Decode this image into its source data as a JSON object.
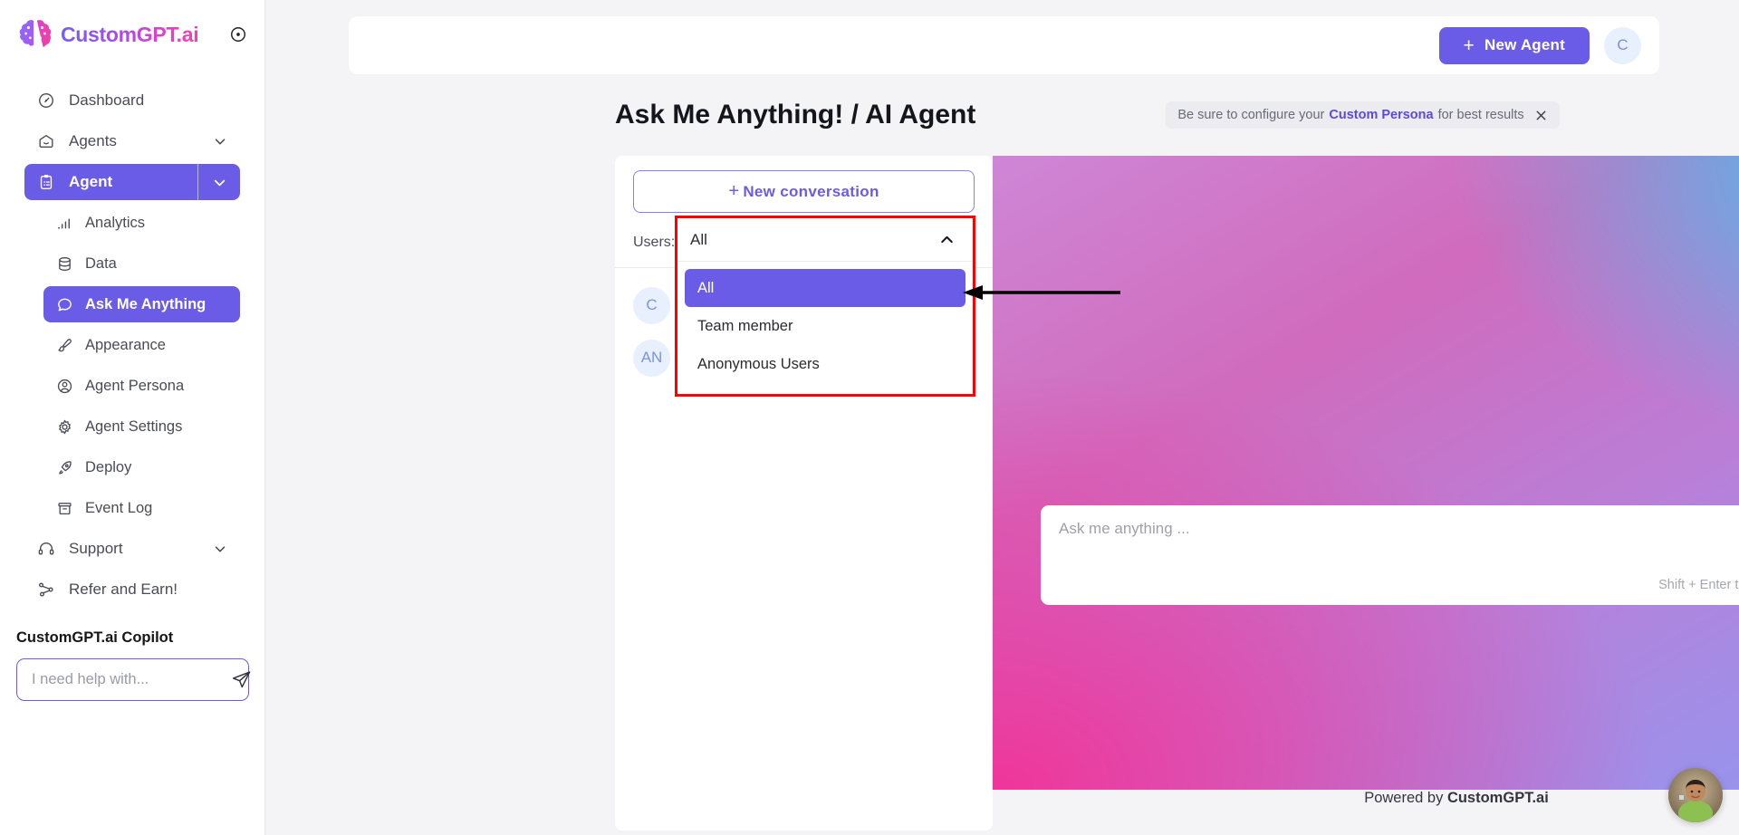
{
  "brand": {
    "name": "CustomGPT.ai",
    "logo_icon": "brain-logo",
    "collapse_icon": "collapse-circle-icon"
  },
  "sidebar": {
    "items": [
      {
        "label": "Dashboard",
        "icon": "dashboard-icon",
        "level": "top",
        "state": "default",
        "chevron": false
      },
      {
        "label": "Agents",
        "icon": "agents-icon",
        "level": "top",
        "state": "default",
        "chevron": true
      },
      {
        "label": "Agent",
        "icon": "clipboard-icon",
        "level": "top",
        "state": "active-split",
        "chevron": true
      },
      {
        "label": "Analytics",
        "icon": "analytics-bars-icon",
        "level": "sub",
        "state": "default",
        "chevron": false
      },
      {
        "label": "Data",
        "icon": "database-icon",
        "level": "sub",
        "state": "default",
        "chevron": false
      },
      {
        "label": "Ask Me Anything",
        "icon": "chat-bubble-icon",
        "level": "sub",
        "state": "active",
        "chevron": false
      },
      {
        "label": "Appearance",
        "icon": "paintbrush-icon",
        "level": "sub",
        "state": "default",
        "chevron": false
      },
      {
        "label": "Agent Persona",
        "icon": "user-circle-icon",
        "level": "sub",
        "state": "default",
        "chevron": false
      },
      {
        "label": "Agent Settings",
        "icon": "gear-icon",
        "level": "sub",
        "state": "default",
        "chevron": false
      },
      {
        "label": "Deploy",
        "icon": "rocket-icon",
        "level": "sub",
        "state": "default",
        "chevron": false
      },
      {
        "label": "Event Log",
        "icon": "archive-box-icon",
        "level": "sub",
        "state": "default",
        "chevron": false
      },
      {
        "label": "Support",
        "icon": "headset-icon",
        "level": "top",
        "state": "default",
        "chevron": true
      },
      {
        "label": "Refer and Earn!",
        "icon": "share-nodes-icon",
        "level": "top",
        "state": "default",
        "chevron": false
      }
    ],
    "copilot": {
      "title": "CustomGPT.ai Copilot",
      "placeholder": "I need help with...",
      "value": "",
      "send_icon": "send-paper-plane-icon"
    }
  },
  "topbar": {
    "new_agent_label": "New Agent",
    "new_agent_plus": "+",
    "avatar_initial": "C"
  },
  "header": {
    "title": "Ask Me Anything! / AI Agent",
    "notice_prefix": "Be sure to configure your",
    "notice_link": "Custom Persona",
    "notice_suffix": "for best results",
    "notice_close_icon": "close-icon",
    "export_icon": "download-document-icon",
    "share_icon": "share-icon"
  },
  "conversations": {
    "new_conversation_label": "New conversation",
    "new_conversation_plus": "+",
    "users_label": "Users:",
    "items": [
      {
        "initials": "C"
      },
      {
        "initials": "AN"
      }
    ]
  },
  "users_dropdown": {
    "selected": "All",
    "caret_icon": "chevron-up-icon",
    "expanded": true,
    "options": [
      {
        "label": "All",
        "selected": true
      },
      {
        "label": "Team member",
        "selected": false
      },
      {
        "label": "Anonymous Users",
        "selected": false
      }
    ],
    "highlight_color": "#ff0000",
    "option_selected_color": "#6b5ce7"
  },
  "chat": {
    "placeholder": "Ask me anything ...",
    "value": "",
    "hint": "Shift + Enter to add a new line",
    "send_icon": "send-paper-plane-icon",
    "powered_prefix": "Powered by",
    "powered_brand": "CustomGPT.ai"
  },
  "widget": {
    "avatar_icon": "chat-widget-avatar"
  },
  "annotation": {
    "arrow_icon": "left-arrow-annotation"
  },
  "colors": {
    "accent": "#6b5ce7",
    "highlight": "#ff0000",
    "page_bg": "#f4f4f6"
  }
}
